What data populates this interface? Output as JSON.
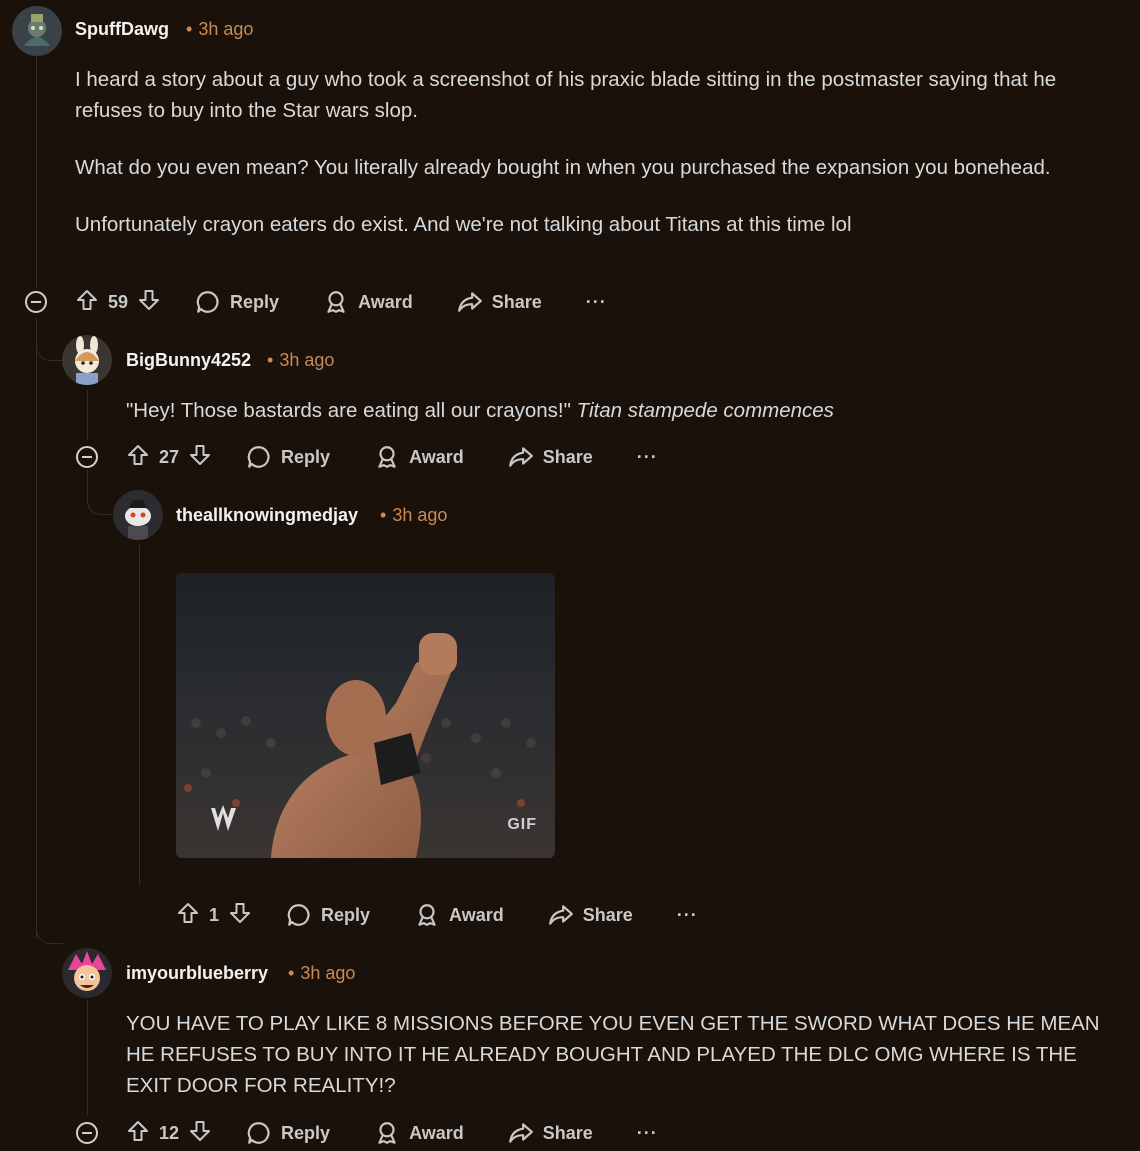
{
  "comments": [
    {
      "username": "SpuffDawg",
      "time": "3h ago",
      "body": [
        "I heard a story about a guy who took a screenshot of his praxic blade sitting in the postmaster saying that he refuses to buy into the Star wars slop.",
        "What do you even mean? You literally already bought in when you purchased the expansion you bonehead.",
        "Unfortunately crayon eaters do exist. And we're not talking about Titans at this time lol"
      ],
      "votes": "59"
    },
    {
      "username": "BigBunny4252",
      "time": "3h ago",
      "body_plain": "\"Hey! Those bastards are eating all our crayons!\"",
      "body_italic": "Titan stampede commences",
      "votes": "27"
    },
    {
      "username": "theallknowingmedjay",
      "time": "3h ago",
      "gif_label": "GIF",
      "votes": "1"
    },
    {
      "username": "imyourblueberry",
      "time": "3h ago",
      "body": "YOU HAVE TO PLAY LIKE 8 MISSIONS BEFORE YOU EVEN GET THE SWORD WHAT DOES HE MEAN HE REFUSES TO BUY INTO IT HE ALREADY BOUGHT AND PLAYED THE DLC OMG WHERE IS THE EXIT DOOR FOR REALITY!?",
      "votes": "12"
    }
  ],
  "actions": {
    "reply": "Reply",
    "award": "Award",
    "share": "Share",
    "more": "···"
  },
  "icons": [
    "upvote-icon",
    "downvote-icon",
    "reply-icon",
    "award-icon",
    "share-icon",
    "collapse-icon",
    "more-icon"
  ],
  "colors": {
    "background": "#1a110a",
    "timestamp": "#c98a57",
    "text": "#d7dadc"
  }
}
